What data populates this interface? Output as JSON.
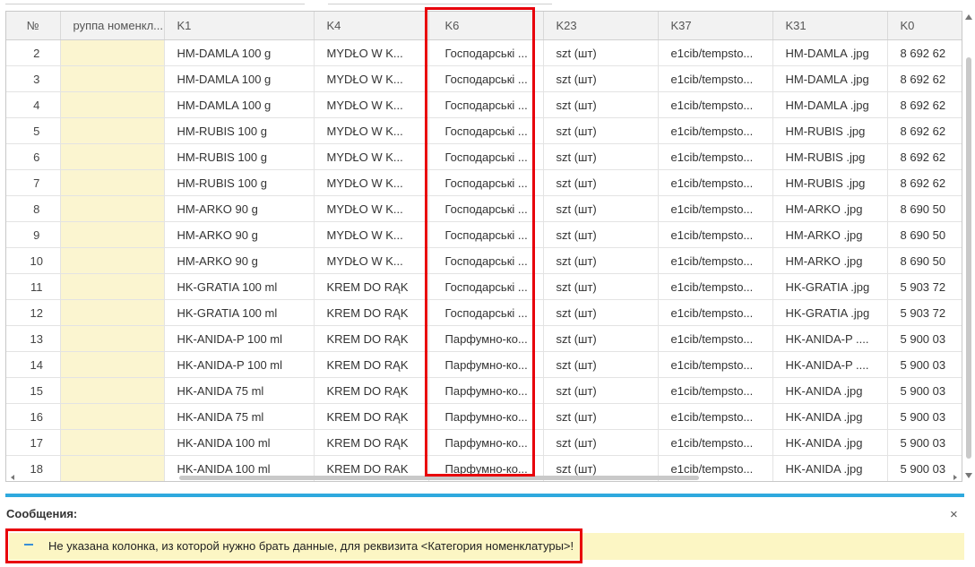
{
  "table": {
    "headers": {
      "num": "№",
      "group": "руппа номенкл...",
      "k1": "K1",
      "k4": "K4",
      "k6": "K6",
      "k23": "K23",
      "k37": "K37",
      "k31": "K31",
      "k0": "K0"
    },
    "rows": [
      {
        "num": "2",
        "group": "",
        "k1": "HM-DAMLA  100 g",
        "k4": "MYDŁO W K...",
        "k6": "Господарські ...",
        "k23": "szt (шт)",
        "k37": "e1cib/tempsto...",
        "k31": "HM-DAMLA .jpg",
        "k0": "8 692 62"
      },
      {
        "num": "3",
        "group": "",
        "k1": "HM-DAMLA  100 g",
        "k4": "MYDŁO W K...",
        "k6": "Господарські ...",
        "k23": "szt (шт)",
        "k37": "e1cib/tempsto...",
        "k31": "HM-DAMLA .jpg",
        "k0": "8 692 62"
      },
      {
        "num": "4",
        "group": "",
        "k1": "HM-DAMLA  100 g",
        "k4": "MYDŁO W K...",
        "k6": "Господарські ...",
        "k23": "szt (шт)",
        "k37": "e1cib/tempsto...",
        "k31": "HM-DAMLA .jpg",
        "k0": "8 692 62"
      },
      {
        "num": "5",
        "group": "",
        "k1": "HM-RUBIS  100 g",
        "k4": "MYDŁO W K...",
        "k6": "Господарські ...",
        "k23": "szt (шт)",
        "k37": "e1cib/tempsto...",
        "k31": "HM-RUBIS .jpg",
        "k0": "8 692 62"
      },
      {
        "num": "6",
        "group": "",
        "k1": "HM-RUBIS  100 g",
        "k4": "MYDŁO W K...",
        "k6": "Господарські ...",
        "k23": "szt (шт)",
        "k37": "e1cib/tempsto...",
        "k31": "HM-RUBIS .jpg",
        "k0": "8 692 62"
      },
      {
        "num": "7",
        "group": "",
        "k1": "HM-RUBIS  100 g",
        "k4": "MYDŁO W K...",
        "k6": "Господарські ...",
        "k23": "szt (шт)",
        "k37": "e1cib/tempsto...",
        "k31": "HM-RUBIS .jpg",
        "k0": "8 692 62"
      },
      {
        "num": "8",
        "group": "",
        "k1": "HM-ARKO  90 g",
        "k4": "MYDŁO W K...",
        "k6": "Господарські ...",
        "k23": "szt (шт)",
        "k37": "e1cib/tempsto...",
        "k31": "HM-ARKO .jpg",
        "k0": "8 690 50"
      },
      {
        "num": "9",
        "group": "",
        "k1": "HM-ARKO  90 g",
        "k4": "MYDŁO W K...",
        "k6": "Господарські ...",
        "k23": "szt (шт)",
        "k37": "e1cib/tempsto...",
        "k31": "HM-ARKO .jpg",
        "k0": "8 690 50"
      },
      {
        "num": "10",
        "group": "",
        "k1": "HM-ARKO  90 g",
        "k4": "MYDŁO W K...",
        "k6": "Господарські ...",
        "k23": "szt (шт)",
        "k37": "e1cib/tempsto...",
        "k31": "HM-ARKO .jpg",
        "k0": "8 690 50"
      },
      {
        "num": "11",
        "group": "",
        "k1": "HK-GRATIA  100 ml",
        "k4": "KREM DO RĄK",
        "k6": "Господарські ...",
        "k23": "szt (шт)",
        "k37": "e1cib/tempsto...",
        "k31": "HK-GRATIA .jpg",
        "k0": "5 903 72"
      },
      {
        "num": "12",
        "group": "",
        "k1": "HK-GRATIA  100 ml",
        "k4": "KREM DO RĄK",
        "k6": "Господарські ...",
        "k23": "szt (шт)",
        "k37": "e1cib/tempsto...",
        "k31": "HK-GRATIA .jpg",
        "k0": "5 903 72"
      },
      {
        "num": "13",
        "group": "",
        "k1": "HK-ANIDA-P  100 ml",
        "k4": "KREM DO RĄK",
        "k6": "Парфумно-ко...",
        "k23": "szt (шт)",
        "k37": "e1cib/tempsto...",
        "k31": "HK-ANIDA-P ....",
        "k0": "5 900 03"
      },
      {
        "num": "14",
        "group": "",
        "k1": "HK-ANIDA-P  100 ml",
        "k4": "KREM DO RĄK",
        "k6": "Парфумно-ко...",
        "k23": "szt (шт)",
        "k37": "e1cib/tempsto...",
        "k31": "HK-ANIDA-P ....",
        "k0": "5 900 03"
      },
      {
        "num": "15",
        "group": "",
        "k1": "HK-ANIDA  75 ml",
        "k4": "KREM DO RĄK",
        "k6": "Парфумно-ко...",
        "k23": "szt (шт)",
        "k37": "e1cib/tempsto...",
        "k31": "HK-ANIDA .jpg",
        "k0": "5 900 03"
      },
      {
        "num": "16",
        "group": "",
        "k1": "HK-ANIDA  75 ml",
        "k4": "KREM DO RĄK",
        "k6": "Парфумно-ко...",
        "k23": "szt (шт)",
        "k37": "e1cib/tempsto...",
        "k31": "HK-ANIDA .jpg",
        "k0": "5 900 03"
      },
      {
        "num": "17",
        "group": "",
        "k1": "HK-ANIDA  100 ml",
        "k4": "KREM DO RĄK",
        "k6": "Парфумно-ко...",
        "k23": "szt (шт)",
        "k37": "e1cib/tempsto...",
        "k31": "HK-ANIDA .jpg",
        "k0": "5 900 03"
      },
      {
        "num": "18",
        "group": "",
        "k1": "HK-ANIDA  100 ml",
        "k4": "KREM DO RAK",
        "k6": "Парфумно-ко...",
        "k23": "szt (шт)",
        "k37": "e1cib/tempsto...",
        "k31": "HK-ANIDA .jpg",
        "k0": "5 900 03"
      }
    ]
  },
  "messages": {
    "title": "Сообщения:",
    "close_icon": "×",
    "items": [
      {
        "text": "Не указана колонка, из которой нужно брать данные, для реквизита <Категория номенклатуры>!"
      }
    ]
  },
  "colors": {
    "highlight": "#e8000b",
    "message_bar": "#2ea9de",
    "message_bg": "#fcf6c4",
    "group_cell_bg": "#fbf5d0"
  }
}
